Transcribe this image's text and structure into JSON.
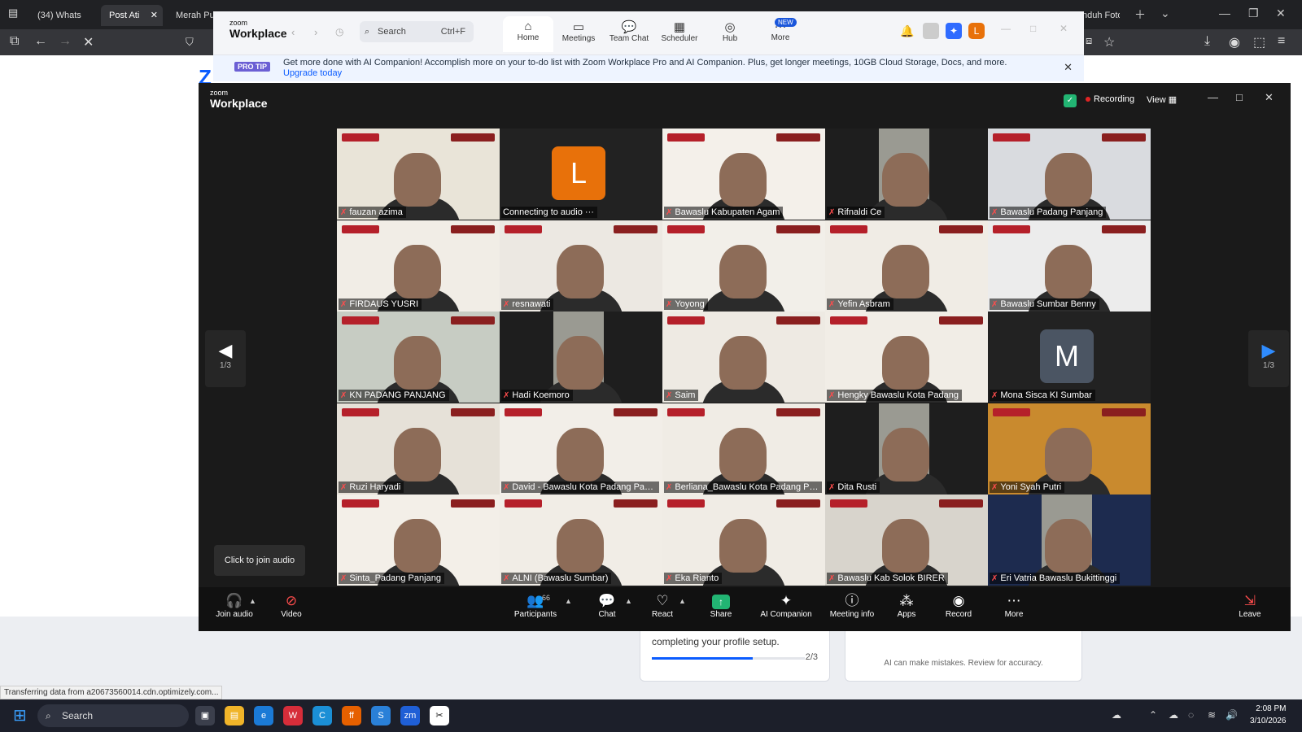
{
  "browser": {
    "tabs": [
      {
        "label": "(34) Whats",
        "badge": "34"
      },
      {
        "label": "Post Ati"
      },
      {
        "label": "Merah Putih"
      },
      {
        "label": "nduh Foto"
      }
    ]
  },
  "zoom_main": {
    "logo_small": "zoom",
    "logo_big": "Workplace",
    "search_placeholder": "Search",
    "search_shortcut": "Ctrl+F",
    "nav": [
      {
        "label": "Home",
        "icon": "home-icon"
      },
      {
        "label": "Meetings",
        "icon": "video-camera-icon"
      },
      {
        "label": "Team Chat",
        "icon": "chat-bubble-icon"
      },
      {
        "label": "Scheduler",
        "icon": "calendar-icon"
      },
      {
        "label": "Hub",
        "icon": "hub-icon"
      },
      {
        "label": "More",
        "icon": "more-dots-icon"
      }
    ],
    "new_badge": "NEW",
    "profile_initial": "L"
  },
  "protip": {
    "badge": "PRO TIP",
    "message": "Get more done with AI Companion! Accomplish more on your to-do list with Zoom Workplace Pro and AI Companion. Plus, get longer meetings, 10GB Cloud Storage, Docs, and more.",
    "link": "Upgrade today"
  },
  "meeting": {
    "title_small": "zoom",
    "title_big": "Workplace",
    "recording_label": "Recording",
    "view_label": "View",
    "tooltip": "Click to join audio",
    "page_left": "1/3",
    "page_right": "1/3",
    "participants": [
      {
        "name": "fauzan azima",
        "type": "video",
        "bg": "#e9e4d8",
        "active": true
      },
      {
        "name": "Connecting to audio ···",
        "type": "avatar",
        "letter": "L",
        "color": "#e8710a"
      },
      {
        "name": "Bawaslu Kabupaten Agam",
        "type": "video",
        "bg": "#f4f0ea"
      },
      {
        "name": "Rifnaldi Ce",
        "type": "video",
        "bg": "#1e1e1e"
      },
      {
        "name": "Bawaslu Padang Panjang",
        "type": "video",
        "bg": "#d9dbdf"
      },
      {
        "name": "FIRDAUS YUSRI",
        "type": "video",
        "bg": "#f1ede6"
      },
      {
        "name": "resnawati",
        "type": "video",
        "bg": "#ece8e2"
      },
      {
        "name": "Yoyong",
        "type": "video",
        "bg": "#f2efe9"
      },
      {
        "name": "Yefin Asbram",
        "type": "video",
        "bg": "#f0ece5"
      },
      {
        "name": "Bawaslu Sumbar Benny",
        "type": "video",
        "bg": "#ececec"
      },
      {
        "name": "KN PADANG PANJANG",
        "type": "video",
        "bg": "#c7ccc3"
      },
      {
        "name": "Hadi Koemoro",
        "type": "video",
        "bg": "#1e1e1e"
      },
      {
        "name": "Saim",
        "type": "video",
        "bg": "#eeeae3"
      },
      {
        "name": "Hengky Bawaslu Kota Padang",
        "type": "video",
        "bg": "#f1ede6"
      },
      {
        "name": "Mona Sisca KI Sumbar",
        "type": "avatar",
        "letter": "M",
        "color": "#4b5563"
      },
      {
        "name": "Ruzi Haryadi",
        "type": "video",
        "bg": "#e6e1d8"
      },
      {
        "name": "David - Bawaslu Kota Padang Panja...",
        "type": "video",
        "bg": "#f2eee8"
      },
      {
        "name": "Berliana_Bawaslu Kota Padang Panj...",
        "type": "video",
        "bg": "#f0ece5"
      },
      {
        "name": "Dita Rusti",
        "type": "video",
        "bg": "#1e1e1e"
      },
      {
        "name": "Yoni Syah Putri",
        "type": "video",
        "bg": "#c98a2e"
      },
      {
        "name": "Sinta_Padang Panjang",
        "type": "video",
        "bg": "#f3efe8"
      },
      {
        "name": "ALNI (Bawaslu Sumbar)",
        "type": "video",
        "bg": "#f1ede6"
      },
      {
        "name": "Eka Rianto",
        "type": "video",
        "bg": "#f0ece5"
      },
      {
        "name": "Bawaslu Kab Solok BIRER",
        "type": "video",
        "bg": "#d8d4cc"
      },
      {
        "name": "Eri Vatria Bawaslu Bukittinggi",
        "type": "video",
        "bg": "#1d2b4f"
      }
    ],
    "toolbar": {
      "join_audio": "Join audio",
      "video": "Video",
      "participants": "Participants",
      "participants_count": "66",
      "chat": "Chat",
      "react": "React",
      "share": "Share",
      "ai_companion": "AI Companion",
      "meeting_info": "Meeting info",
      "apps": "Apps",
      "record": "Record",
      "more": "More",
      "leave": "Leave"
    }
  },
  "background": {
    "onboarding_text": "completing your profile setup.",
    "onboarding_progress": "2/3",
    "onboarding_fraction": 0.66,
    "ai_disclaimer": "AI can make mistakes. Review for accuracy.",
    "status_text": "Transferring data from a20673560014.cdn.optimizely.com..."
  },
  "taskbar": {
    "search_placeholder": "Search",
    "time": "2:08 PM",
    "date": "3/10/2026"
  }
}
